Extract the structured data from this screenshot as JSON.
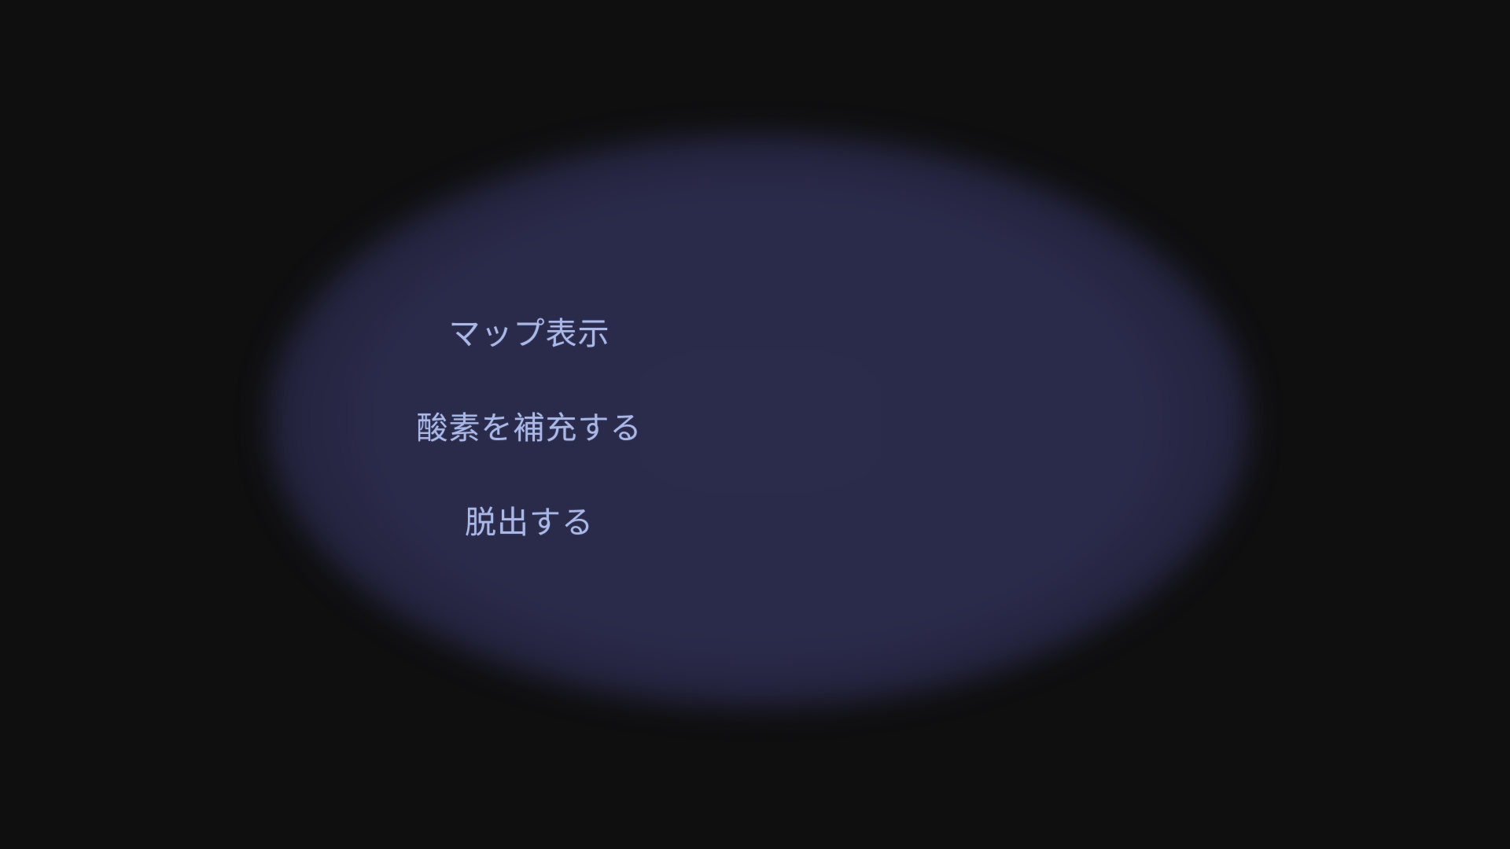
{
  "menu": {
    "items": [
      {
        "label": "マップ表示"
      },
      {
        "label": "酸素を補充する"
      },
      {
        "label": "脱出する"
      }
    ]
  },
  "colors": {
    "background": "#0f0f10",
    "panel_glow": "#2b2b4c",
    "text": "#a9b8e6"
  }
}
